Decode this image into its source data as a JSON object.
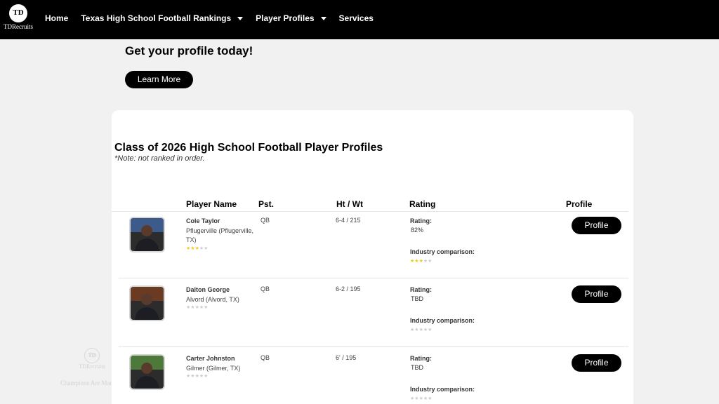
{
  "nav": {
    "logo_mark": "TD",
    "logo_text": "TDRecruits",
    "items": [
      {
        "label": "Home"
      },
      {
        "label": "Texas High School Football Rankings"
      },
      {
        "label": "Player Profiles"
      },
      {
        "label": "Services"
      }
    ]
  },
  "promo": {
    "title": "Get your profile today!",
    "button": "Learn More"
  },
  "section": {
    "title": "Class of 2026 High School Football Player Profiles",
    "note": "*Note: not ranked in order."
  },
  "table": {
    "headers": {
      "name": "Player Name",
      "position": "Pst.",
      "htwt": "Ht / Wt",
      "rating": "Rating",
      "profile": "Profile"
    },
    "rating_label": "Rating:",
    "industry_label": "Industry comparison:",
    "profile_button": "Profile",
    "rows": [
      {
        "name": "Cole Taylor",
        "school": "Pflugerville (Pflugerville, TX)",
        "position": "QB",
        "htwt": "6-4 / 215",
        "rating": "82%",
        "stars": 3,
        "industry_stars": 3,
        "photo_color": "#3c5a8a"
      },
      {
        "name": "Dalton George",
        "school": "Alvord (Alvord, TX)",
        "position": "QB",
        "htwt": "6-2 / 195",
        "rating": "TBD",
        "stars": 0,
        "industry_stars": 0,
        "photo_color": "#6b3a22"
      },
      {
        "name": "Carter Johnston",
        "school": "Gilmer (Gilmer, TX)",
        "position": "QB",
        "htwt": "6' / 195",
        "rating": "TBD",
        "stars": 0,
        "industry_stars": 0,
        "photo_color": "#4d7a3a"
      }
    ]
  },
  "watermark": {
    "mark": "TD",
    "sub": "TDRecruits",
    "text": "Champions Are Made Here"
  }
}
